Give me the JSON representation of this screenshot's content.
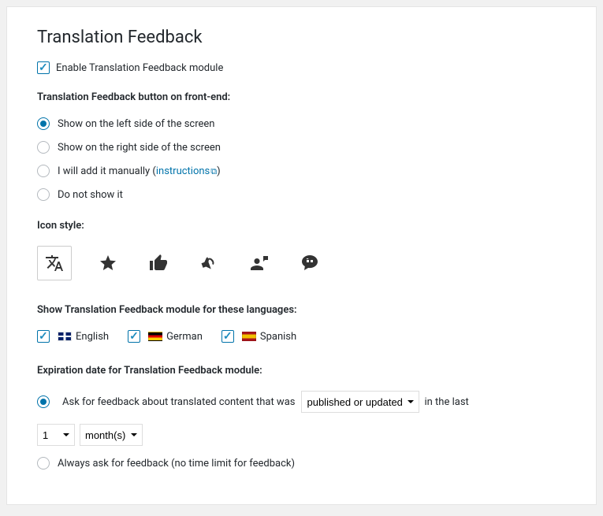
{
  "title": "Translation Feedback",
  "enable": {
    "label": "Enable Translation Feedback module",
    "checked": true
  },
  "button_position": {
    "heading": "Translation Feedback button on front-end:",
    "options": {
      "left": "Show on the left side of the screen",
      "right": "Show on the right side of the screen",
      "manual_prefix": "I will add it manually (",
      "manual_link": "instructions",
      "manual_suffix": ")",
      "none": "Do not show it"
    },
    "selected": "left"
  },
  "icon_style": {
    "heading": "Icon style:",
    "options": [
      "translate-icon",
      "star-icon",
      "thumb-up-icon",
      "megaphone-icon",
      "person-comment-icon",
      "speech-bubble-icon"
    ],
    "selected": "translate-icon"
  },
  "languages_section": {
    "heading": "Show Translation Feedback module for these languages:",
    "items": [
      {
        "code": "en",
        "label": "English",
        "checked": true
      },
      {
        "code": "de",
        "label": "German",
        "checked": true
      },
      {
        "code": "es",
        "label": "Spanish",
        "checked": true
      }
    ]
  },
  "expiration": {
    "heading": "Expiration date for Translation Feedback module:",
    "option_timed_prefix": "Ask for feedback about translated content that was",
    "trigger_select": {
      "value": "published or updated",
      "options": [
        "published or updated"
      ]
    },
    "mid_text": "in the last",
    "amount_select": {
      "value": "1",
      "options": [
        "1"
      ]
    },
    "unit_select": {
      "value": "month(s)",
      "options": [
        "month(s)"
      ]
    },
    "option_always": "Always ask for feedback (no time limit for feedback)",
    "selected": "timed"
  }
}
